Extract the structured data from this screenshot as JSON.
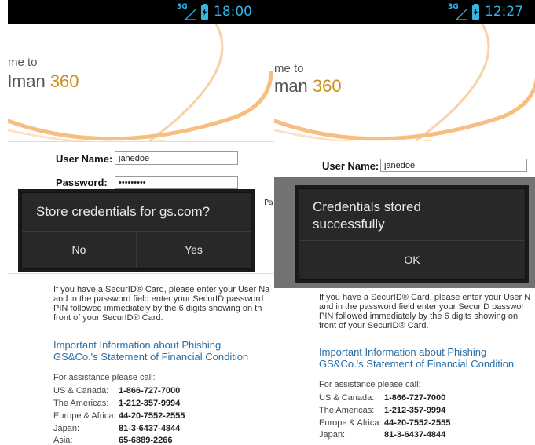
{
  "left": {
    "status": {
      "network": "3G",
      "time": "18:00"
    },
    "header": {
      "welcome": "me to",
      "brand_name": "lman",
      "brand_number": "360"
    },
    "form": {
      "username_label": "User Name:",
      "username_value": "janedoe",
      "password_label": "Password:",
      "password_value": "•••••••••",
      "edge_text": "Pa"
    },
    "dialog": {
      "title": "Store credentials for gs.com?",
      "no_label": "No",
      "yes_label": "Yes"
    },
    "info_lines": [
      "If you have a SecurID® Card, please enter your User Na",
      "and in the password field enter your SecurID password",
      "PIN followed immediately by the 6 digits showing on th",
      "front of your SecurID® Card."
    ],
    "links": [
      "Important Information about Phishing",
      "GS&Co.'s Statement of Financial Condition"
    ],
    "assistance_title": "For assistance please call:",
    "contacts": [
      {
        "region": "US & Canada:",
        "phone": "1-866-727-7000"
      },
      {
        "region": "The Americas:",
        "phone": "1-212-357-9994"
      },
      {
        "region": "Europe & Africa:",
        "phone": "44-20-7552-2555"
      },
      {
        "region": "Japan:",
        "phone": "81-3-6437-4844"
      },
      {
        "region": "Asia:",
        "phone": "65-6889-2266"
      }
    ]
  },
  "right": {
    "status": {
      "network": "3G",
      "time": "12:27"
    },
    "header": {
      "welcome": "me to",
      "brand_name": "man",
      "brand_number": "360"
    },
    "form": {
      "username_label": "User Name:",
      "username_value": "janedoe"
    },
    "dialog": {
      "title_line1": "Credentials stored",
      "title_line2": "successfully",
      "ok_label": "OK"
    },
    "info_lines": [
      "If you have a SecurID® Card, please enter your User N",
      "and in the password field enter your SecurID passwor",
      "PIN followed immediately by the 6 digits showing on",
      "front of your SecurID® Card."
    ],
    "links": [
      "Important Information about Phishing",
      "GS&Co.'s Statement of Financial Condition"
    ],
    "assistance_title": "For assistance please call:",
    "contacts": [
      {
        "region": "US & Canada:",
        "phone": "1-866-727-7000"
      },
      {
        "region": "The Americas:",
        "phone": "1-212-357-9994"
      },
      {
        "region": "Europe & Africa:",
        "phone": "44-20-7552-2555"
      },
      {
        "region": "Japan:",
        "phone": "81-3-6437-4844"
      }
    ]
  },
  "colors": {
    "status_accent": "#33b5e5",
    "brand_accent": "#c8901c",
    "dialog_bg": "#282828",
    "link": "#2a6ea6",
    "arc": "#f2a34a"
  },
  "icons": [
    "signal-icon",
    "battery-charging-icon"
  ]
}
